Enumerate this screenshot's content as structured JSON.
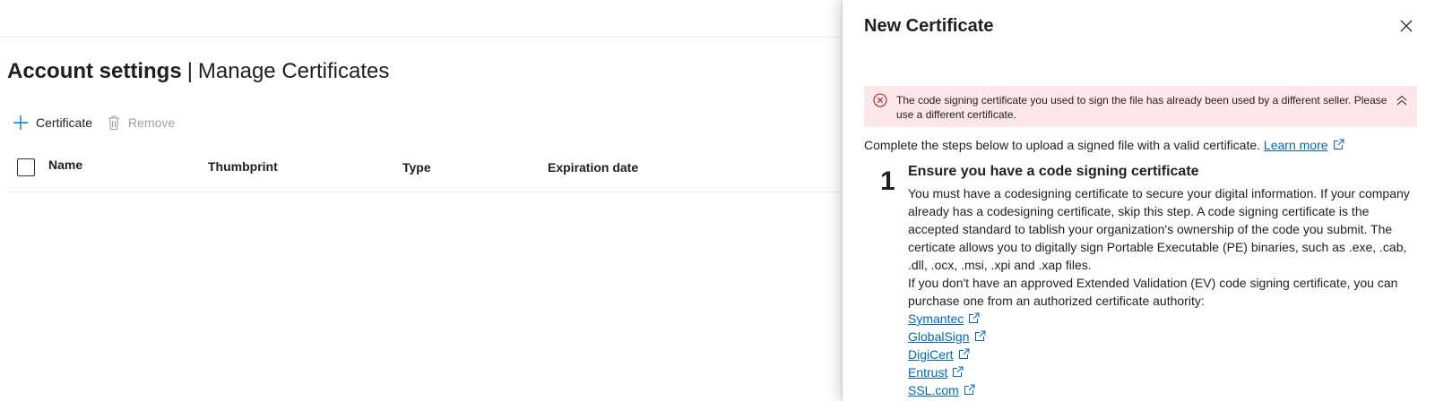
{
  "page": {
    "title_bold": "Account settings",
    "title_sep": "|",
    "title_sub": "Manage Certificates"
  },
  "toolbar": {
    "add_label": "Certificate",
    "remove_label": "Remove"
  },
  "table": {
    "columns": [
      "Name",
      "Thumbprint",
      "Type",
      "Expiration date"
    ]
  },
  "panel": {
    "title": "New Certificate",
    "error_message": "The code signing certificate you used to sign the file has already been used by a different seller. Please use a different certificate.",
    "intro_text": "Complete the steps below to upload a signed file with a valid certificate.",
    "learn_more": "Learn more",
    "step": {
      "number": "1",
      "title": "Ensure you have a code signing certificate",
      "paragraph1": "You must have a codesigning certificate to secure your digital information. If your company already has a codesigning certificate, skip this step. A code signing certificate is the accepted standard to tablish your organization's ownership of the code you submit. The certicate allows you to digitally sign Portable Executable (PE) binaries, such as .exe, .cab, .dll, .ocx, .msi, .xpi and .xap files.",
      "paragraph2": "If you don't have an approved Extended Validation (EV) code signing certificate, you can purchase one from an authorized certificate authority:",
      "authorities": [
        "Symantec",
        "GlobalSign",
        "DigiCert",
        "Entrust",
        "SSL.com"
      ]
    }
  },
  "colors": {
    "link": "#0066b8",
    "error_bg": "#fde7e9",
    "error_icon": "#a4262c",
    "accent": "#0078d4",
    "disabled": "#a19f9d"
  },
  "icons": {
    "add": "plus-icon",
    "remove": "trash-icon",
    "close": "close-icon",
    "error": "error-circle-icon",
    "collapse": "chevron-double-up-icon",
    "external": "external-link-icon"
  }
}
